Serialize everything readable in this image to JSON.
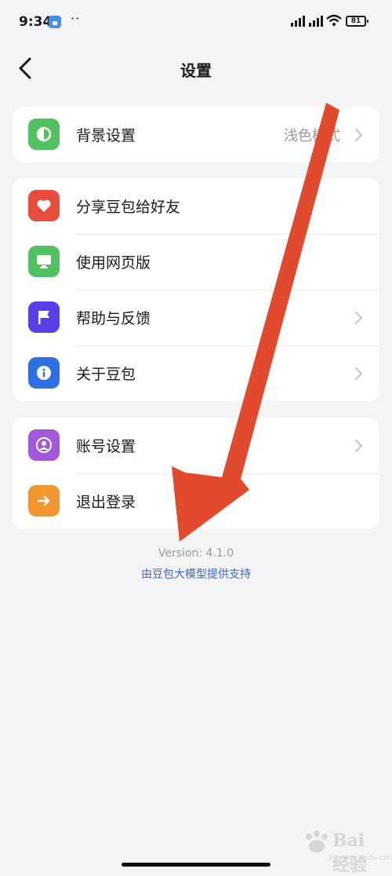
{
  "status_bar": {
    "time": "9:34",
    "dots": "··",
    "battery": "81"
  },
  "header": {
    "title": "设置"
  },
  "groups": [
    {
      "items": [
        {
          "label": "背景设置",
          "value": "浅色模式",
          "icon": "half-circle-icon",
          "color": "#52c162"
        }
      ]
    },
    {
      "items": [
        {
          "label": "分享豆包给好友",
          "icon": "heart-icon",
          "color": "#e84c3d"
        },
        {
          "label": "使用网页版",
          "icon": "monitor-icon",
          "color": "#52c162"
        },
        {
          "label": "帮助与反馈",
          "icon": "flag-icon",
          "color": "#5a3ee8"
        },
        {
          "label": "关于豆包",
          "icon": "info-icon",
          "color": "#2f6fe4"
        }
      ]
    },
    {
      "items": [
        {
          "label": "账号设置",
          "icon": "user-icon",
          "color": "#a259d9"
        },
        {
          "label": "退出登录",
          "icon": "arrow-right-icon",
          "color": "#f0982f"
        }
      ]
    }
  ],
  "footer": {
    "version": "Version: 4.1.0",
    "powered_by": "由豆包大模型提供支持"
  },
  "watermark": {
    "text": "Bai经验",
    "url": "jingyan.baidu.com"
  },
  "overlay": {
    "arrow_color": "#e24a2d"
  }
}
